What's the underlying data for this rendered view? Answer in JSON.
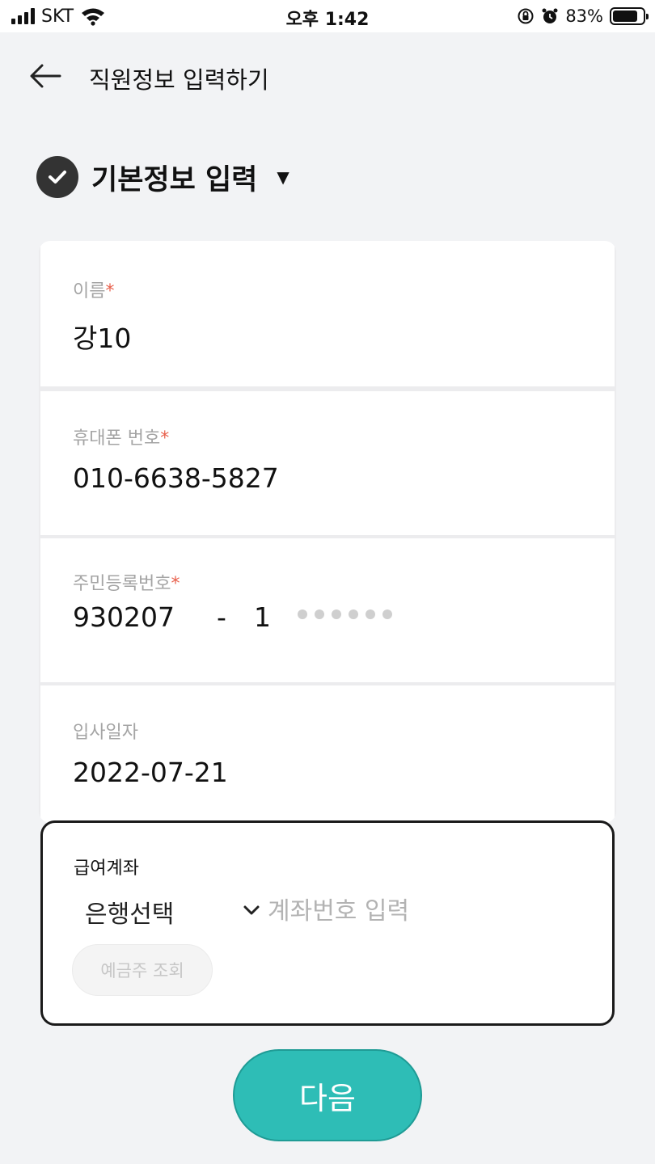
{
  "status_bar": {
    "carrier": "SKT",
    "time": "오후 1:42",
    "battery": "83%",
    "battery_level": 0.83
  },
  "header": {
    "title": "직원정보 입력하기"
  },
  "section": {
    "title": "기본정보 입력",
    "caret": "▼"
  },
  "fields": {
    "name": {
      "label": "이름",
      "required_mark": "*",
      "value": "강10"
    },
    "phone": {
      "label": "휴대폰 번호",
      "required_mark": "*",
      "value": "010-6638-5827"
    },
    "rrn": {
      "label": "주민등록번호",
      "required_mark": "*",
      "front": "930207",
      "separator": "-",
      "back_first": "1"
    },
    "join_date": {
      "label": "입사일자",
      "value": "2022-07-21"
    }
  },
  "account": {
    "label": "급여계좌",
    "bank_select": "은행선택",
    "account_placeholder": "계좌번호 입력",
    "holder_button": "예금주 조회"
  },
  "next_button": "다음",
  "colors": {
    "accent": "#2ebdb6",
    "required": "#e8604c",
    "background": "#f2f3f5"
  }
}
